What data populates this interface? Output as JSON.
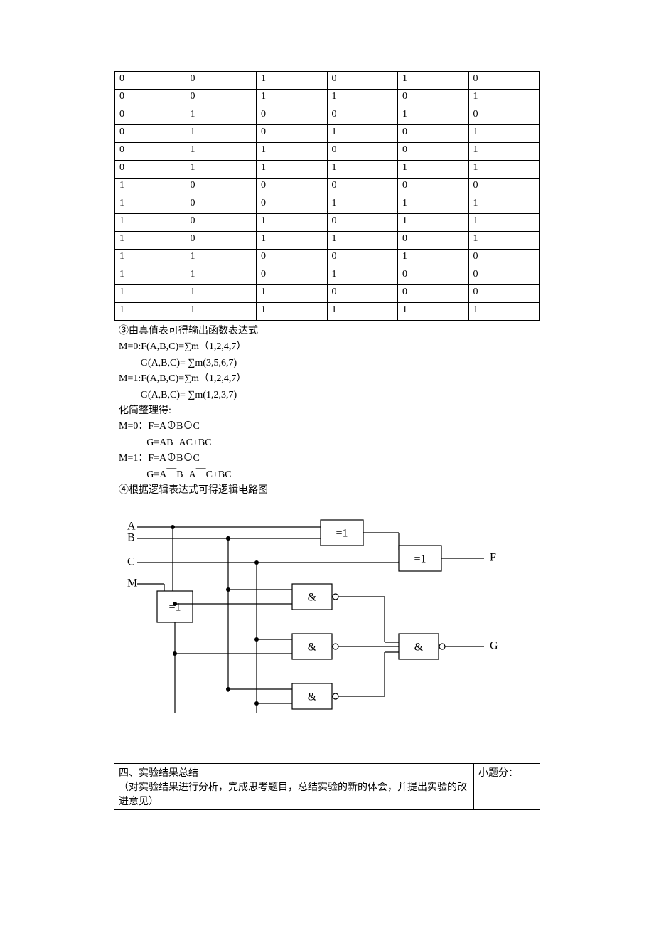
{
  "truth_table": {
    "rows": [
      [
        "0",
        "0",
        "1",
        "0",
        "1",
        "0"
      ],
      [
        "0",
        "0",
        "1",
        "1",
        "0",
        "1"
      ],
      [
        "0",
        "1",
        "0",
        "0",
        "1",
        "0"
      ],
      [
        "0",
        "1",
        "0",
        "1",
        "0",
        "1"
      ],
      [
        "0",
        "1",
        "1",
        "0",
        "0",
        "1"
      ],
      [
        "0",
        "1",
        "1",
        "1",
        "1",
        "1"
      ],
      [
        "1",
        "0",
        "0",
        "0",
        "0",
        "0"
      ],
      [
        "1",
        "0",
        "0",
        "1",
        "1",
        "1"
      ],
      [
        "1",
        "0",
        "1",
        "0",
        "1",
        "1"
      ],
      [
        "1",
        "0",
        "1",
        "1",
        "0",
        "1"
      ],
      [
        "1",
        "1",
        "0",
        "0",
        "1",
        "0"
      ],
      [
        "1",
        "1",
        "0",
        "1",
        "0",
        "0"
      ],
      [
        "1",
        "1",
        "1",
        "0",
        "0",
        "0"
      ],
      [
        "1",
        "1",
        "1",
        "1",
        "1",
        "1"
      ]
    ]
  },
  "analysis": {
    "line3": "③由真值表可得输出函数表达式",
    "m0_f": "M=0:F(A,B,C)=∑m（1,2,4,7）",
    "m0_g": "G(A,B,C)= ∑m(3,5,6,7)",
    "m1_f": "M=1:F(A,B,C)=∑m（1,2,4,7）",
    "m1_g": "G(A,B,C)= ∑m(1,2,3,7)",
    "simp_header": "化简整理得:",
    "s_m0_f": "M=0：F=A⊕B⊕C",
    "s_m0_g": "G=AB+AC+BC",
    "s_m1_f": "M=1：F=A⊕B⊕C",
    "s_m1_g": "G=A￣B+A￣C+BC",
    "line4": "④根据逻辑表达式可得逻辑电路图"
  },
  "circuit": {
    "inputs": {
      "a": "A",
      "b": "B",
      "c": "C",
      "m": "M"
    },
    "outputs": {
      "f": "F",
      "g": "G"
    },
    "gates": {
      "xor": "=1",
      "and": "&"
    }
  },
  "section4": {
    "title": "四、实验结果总结",
    "desc": "（对实验结果进行分析，完成思考题目，总结实验的新的体会，并提出实验的改进意见）",
    "score_label": "小题分："
  }
}
